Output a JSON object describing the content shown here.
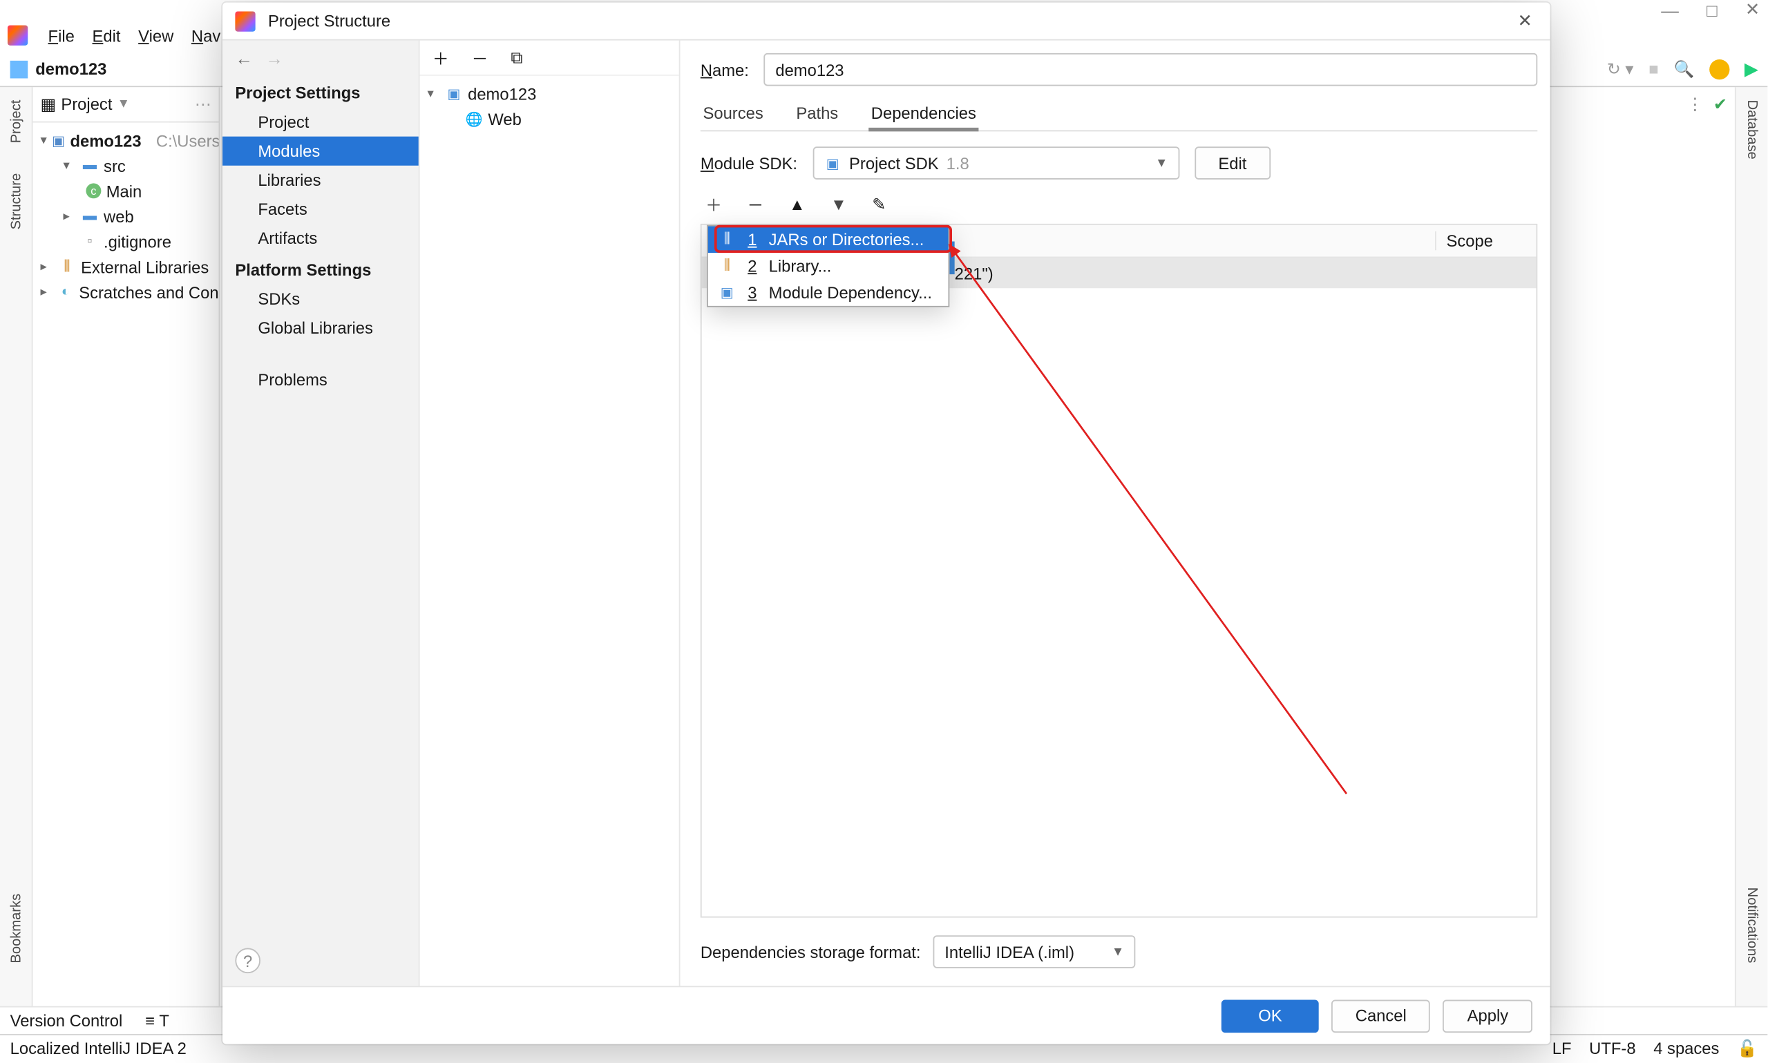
{
  "ide": {
    "menu": {
      "file": "File",
      "edit": "Edit",
      "view": "View",
      "nav": "Nav"
    },
    "breadcrumb": "demo123",
    "toolbar_right": {
      "run": " ",
      "stop": " ",
      "search": " "
    },
    "project_tool": {
      "title": "Project"
    },
    "tree": {
      "root": "demo123",
      "root_hint": "C:\\Users",
      "src": "src",
      "main": "Main",
      "web": "web",
      "gitignore": ".gitignore",
      "ext": "External Libraries",
      "scratches": "Scratches and Con"
    },
    "left_tabs": {
      "project": "Project",
      "structure": "Structure",
      "bookmarks": "Bookmarks"
    },
    "right_tabs": {
      "database": "Database",
      "notifications": "Notifications"
    },
    "toolwindows": {
      "vcs": "Version Control",
      "todo": "T"
    },
    "status": {
      "msg": "Localized IntelliJ IDEA 2",
      "lf": "LF",
      "enc": "UTF-8",
      "indent": "4 spaces"
    }
  },
  "dialog": {
    "title": "Project Structure",
    "nav": {
      "back": "←",
      "fwd": "→",
      "g1": "Project Settings",
      "items1": [
        "Project",
        "Modules",
        "Libraries",
        "Facets",
        "Artifacts"
      ],
      "g2": "Platform Settings",
      "items2": [
        "SDKs",
        "Global Libraries"
      ],
      "problems": "Problems",
      "help": "?"
    },
    "modules": {
      "root": "demo123",
      "web": "Web",
      "add": "＋",
      "remove": "－",
      "copy": "⧉"
    },
    "main": {
      "name_label": "Name:",
      "name_value": "demo123",
      "tabs": {
        "sources": "Sources",
        "paths": "Paths",
        "deps": "Dependencies"
      },
      "sdk_label": "Module SDK:",
      "sdk_value": "Project SDK",
      "sdk_version": "1.8",
      "edit": "Edit",
      "scope_header": "Scope",
      "hidden_row_tail": "221\")",
      "storage_label": "Dependencies storage format:",
      "storage_value": "IntelliJ IDEA (.iml)"
    },
    "popup": {
      "i1": {
        "n": "1",
        "label": "JARs or Directories..."
      },
      "i2": {
        "n": "2",
        "label": "Library..."
      },
      "i3": {
        "n": "3",
        "label": "Module Dependency..."
      }
    },
    "buttons": {
      "ok": "OK",
      "cancel": "Cancel",
      "apply": "Apply"
    }
  },
  "win": {
    "min": "—",
    "max": "□",
    "close": "✕"
  }
}
